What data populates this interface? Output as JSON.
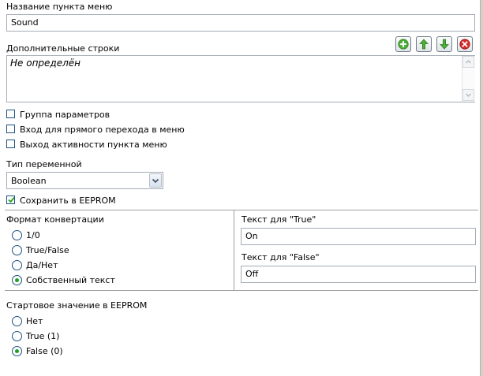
{
  "menu_item_name": {
    "label": "Название пункта меню",
    "value": "Sound"
  },
  "extra_lines": {
    "label": "Дополнительные строки",
    "value": "Не определён"
  },
  "toolbar": {
    "add_icon": "plus-circle-icon",
    "up_icon": "arrow-up-icon",
    "down_icon": "arrow-down-icon",
    "delete_icon": "delete-circle-icon"
  },
  "options": [
    {
      "label": "Группа параметров",
      "checked": false
    },
    {
      "label": "Вход для прямого перехода в меню",
      "checked": false
    },
    {
      "label": "Выход активности пункта меню",
      "checked": false
    }
  ],
  "variable_type": {
    "label": "Тип переменной",
    "value": "Boolean"
  },
  "save_eeprom": {
    "label": "Сохранить в EEPROM",
    "checked": true
  },
  "conversion": {
    "label": "Формат конвертации",
    "options": [
      "1/0",
      "True/False",
      "Да/Нет",
      "Собственный текст"
    ],
    "selected": "Собственный текст"
  },
  "true_text": {
    "label": "Текст для \"True\"",
    "value": "On"
  },
  "false_text": {
    "label": "Текст для \"False\"",
    "value": "Off"
  },
  "initial_value": {
    "label": "Стартовое значение в EEPROM",
    "options": [
      "Нет",
      "True (1)",
      "False (0)"
    ],
    "selected": "False (0)"
  },
  "colors": {
    "accent_green": "#21a121",
    "border_blue": "#1c5180",
    "delete_red": "#d62b2b"
  }
}
